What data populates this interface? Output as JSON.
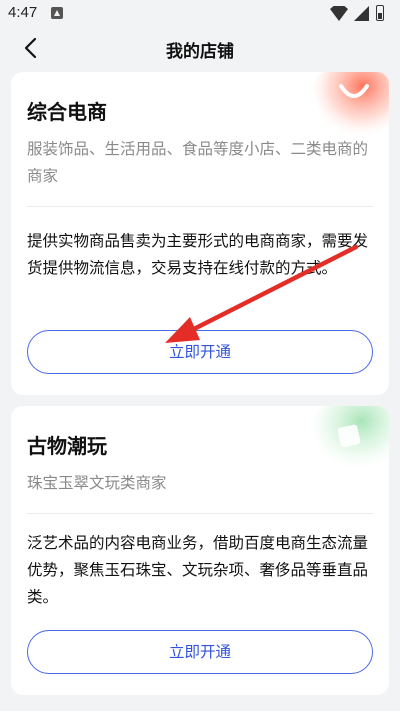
{
  "status_bar": {
    "time": "4:47"
  },
  "header": {
    "title": "我的店铺"
  },
  "cards": [
    {
      "title": "综合电商",
      "subtitle": "服装饰品、生活用品、食品等度小店、二类电商的商家",
      "description": "提供实物商品售卖为主要形式的电商商家，需要发货提供物流信息，交易支持在线付款的方式。",
      "button_label": "立即开通",
      "accent_color": "#ff6a4d"
    },
    {
      "title": "古物潮玩",
      "subtitle": "珠宝玉翠文玩类商家",
      "description": "泛艺术品的内容电商业务，借助百度电商生态流量优势，聚焦玉石珠宝、文玩杂项、奢侈品等垂直品类。",
      "button_label": "立即开通",
      "accent_color": "#5fcf7a"
    }
  ],
  "colors": {
    "background": "#f2f3f5",
    "button_border": "#4a68e8",
    "button_text": "#3254dc",
    "annotation_arrow": "#e52d27"
  }
}
